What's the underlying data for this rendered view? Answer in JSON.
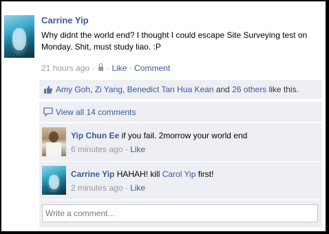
{
  "post": {
    "author": "Carrine Yip",
    "text": "Why didnt the world end? I thought I could escape Site Surveying test on Monday. Shit, must study liao. :P",
    "time": "21 hours ago",
    "dot1": "·",
    "dot2": "·",
    "like_label": "Like",
    "comment_label": "Comment"
  },
  "likes": {
    "name1": "Amy Goh",
    "sep1": ", ",
    "name2": "Zi Yang",
    "sep2": ", ",
    "name3": "Benedict Tan Hua Kean",
    "and": " and ",
    "others": "26 others",
    "suffix": " like this."
  },
  "view_all": "View all 14 comments",
  "comments": [
    {
      "author": "Yip Chun Ee",
      "text": " if you fail. 2morrow your world end",
      "time": "6 minutes ago",
      "dot": "·",
      "like_label": "Like"
    },
    {
      "author": "Carrine Yip",
      "text_before": " HAHAH! kill ",
      "mention": "Carol Yip",
      "text_after": " first!",
      "time": "2 minutes ago",
      "dot": "·",
      "like_label": "Like"
    }
  ],
  "write": {
    "placeholder": "Write a comment..."
  },
  "colors": {
    "link": "#3b5998",
    "panel": "#edeff4",
    "meta": "#999999"
  },
  "icons": [
    "privacy-lock-icon",
    "thumbs-up-icon",
    "comment-bubble-icon"
  ]
}
